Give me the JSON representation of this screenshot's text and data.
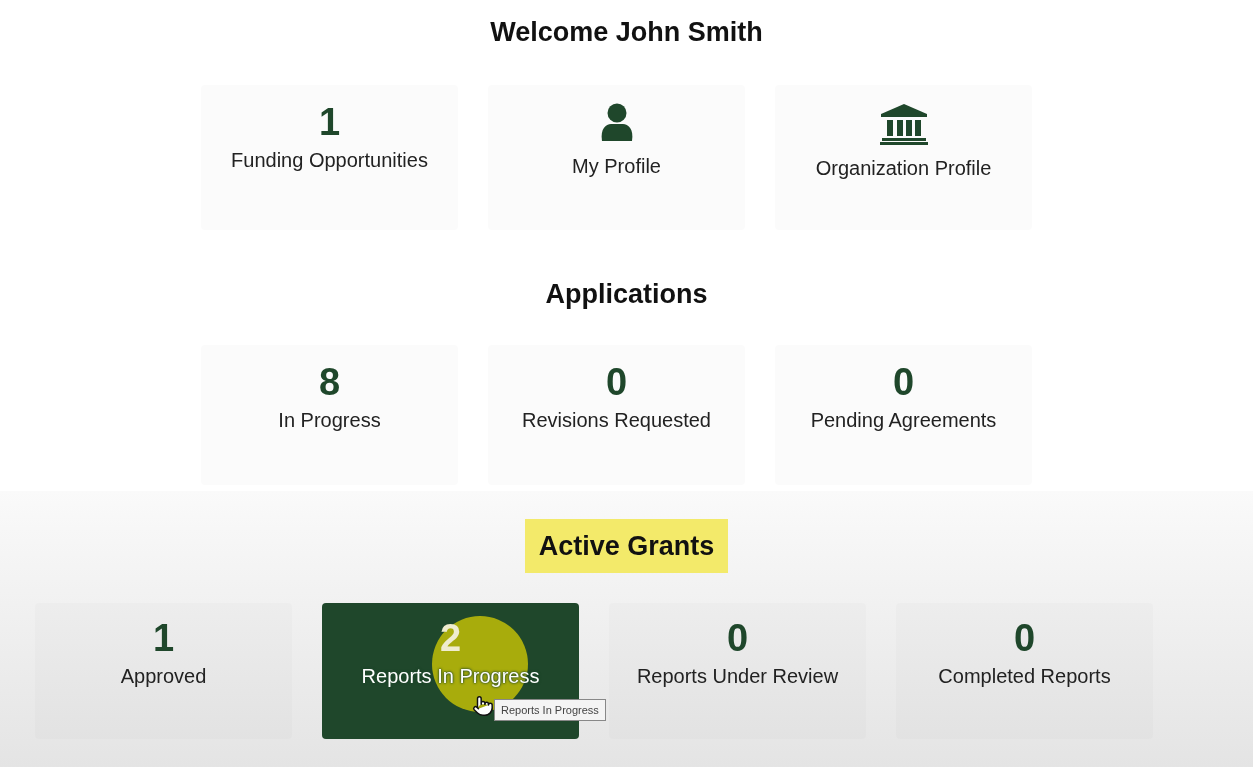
{
  "welcome": {
    "title": "Welcome John Smith",
    "cards": [
      {
        "kind": "count",
        "value": "1",
        "label": "Funding Opportunities"
      },
      {
        "kind": "person",
        "label": "My Profile"
      },
      {
        "kind": "building",
        "label": "Organization Profile"
      }
    ]
  },
  "applications": {
    "title": "Applications",
    "cards": [
      {
        "kind": "count",
        "value": "8",
        "label": "In Progress"
      },
      {
        "kind": "count",
        "value": "0",
        "label": "Revisions Requested"
      },
      {
        "kind": "count",
        "value": "0",
        "label": "Pending Agreements"
      }
    ]
  },
  "active_grants": {
    "title": "Active Grants",
    "title_highlighted": true,
    "cards": [
      {
        "value": "1",
        "label": "Approved",
        "hovered": false
      },
      {
        "value": "2",
        "label": "Reports In Progress",
        "hovered": true,
        "tooltip": "Reports In Progress"
      },
      {
        "value": "0",
        "label": "Reports Under Review",
        "hovered": false
      },
      {
        "value": "0",
        "label": "Completed Reports",
        "hovered": false
      }
    ]
  }
}
